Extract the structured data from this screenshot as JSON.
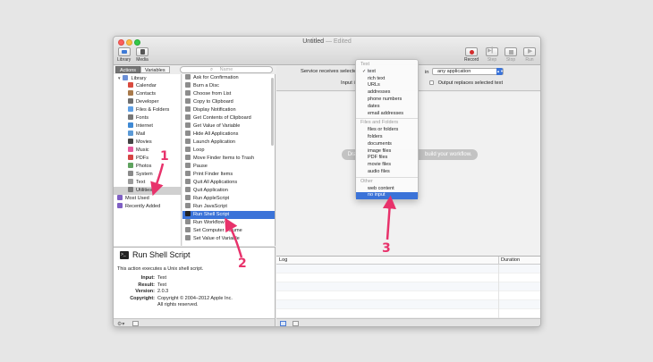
{
  "window": {
    "title": "Untitled",
    "title_suffix": "— Edited"
  },
  "toolbar": {
    "library_label": "Library",
    "media_label": "Media",
    "record_label": "Record",
    "step_label": "Step",
    "stop_label": "Stop",
    "run_label": "Run"
  },
  "library": {
    "actions_tab": "Actions",
    "variables_tab": "Variables",
    "search_placeholder": "Name",
    "categories": [
      {
        "label": "Library",
        "color": "#6b8fd6"
      },
      {
        "label": "Calendar",
        "color": "#d94b3f"
      },
      {
        "label": "Contacts",
        "color": "#a97a4b"
      },
      {
        "label": "Developer",
        "color": "#6f6f6f"
      },
      {
        "label": "Files & Folders",
        "color": "#5ea0e6"
      },
      {
        "label": "Fonts",
        "color": "#777777"
      },
      {
        "label": "Internet",
        "color": "#3f89d4"
      },
      {
        "label": "Mail",
        "color": "#5c9ad6"
      },
      {
        "label": "Movies",
        "color": "#444444"
      },
      {
        "label": "Music",
        "color": "#e55a9e"
      },
      {
        "label": "PDFs",
        "color": "#d64444"
      },
      {
        "label": "Photos",
        "color": "#5fa35f"
      },
      {
        "label": "System",
        "color": "#8a8a8a"
      },
      {
        "label": "Text",
        "color": "#9b9b9b"
      },
      {
        "label": "Utilities",
        "color": "#7b7b7b"
      },
      {
        "label": "Most Used",
        "color": "#7f5fc4"
      },
      {
        "label": "Recently Added",
        "color": "#7f5fc4"
      }
    ],
    "actions": [
      "Ask for Confirmation",
      "Burn a Disc",
      "Choose from List",
      "Copy to Clipboard",
      "Display Notification",
      "Get Contents of Clipboard",
      "Get Value of Variable",
      "Hide All Applications",
      "Launch Application",
      "Loop",
      "Move Finder Items to Trash",
      "Pause",
      "Print Finder Items",
      "Quit All Applications",
      "Quit Application",
      "Run AppleScript",
      "Run JavaScript",
      "Run Shell Script",
      "Run Workflow",
      "Set Computer Volume",
      "Set Value of Variable"
    ]
  },
  "description": {
    "title": "Run Shell Script",
    "icon_text": ">_",
    "text": "This action executes a Unix shell script.",
    "input_label": "Input:",
    "input_value": "Text",
    "result_label": "Result:",
    "result_value": "Text",
    "version_label": "Version:",
    "version_value": "2.0.3",
    "copyright_label": "Copyright:",
    "copyright_value": "Copyright © 2004–2012 Apple Inc. All rights reserved."
  },
  "workflow": {
    "service_label": "Service receives selected",
    "input_label": "Input i",
    "in_label": "in",
    "app_value": "any application",
    "output_checkbox": "Output replaces selected text",
    "hint_left": "Drag",
    "hint_right": "build your workflow.",
    "log_header": "Log",
    "duration_header": "Duration"
  },
  "dropdown": {
    "items": [
      {
        "label": "Text",
        "type": "section"
      },
      {
        "label": "text",
        "type": "item",
        "checked": true
      },
      {
        "label": "rich text",
        "type": "item"
      },
      {
        "label": "URLs",
        "type": "item"
      },
      {
        "label": "addresses",
        "type": "item"
      },
      {
        "label": "phone numbers",
        "type": "item"
      },
      {
        "label": "dates",
        "type": "item"
      },
      {
        "label": "email addresses",
        "type": "item"
      },
      {
        "label": "Files and Folders",
        "type": "section"
      },
      {
        "label": "files or folders",
        "type": "item"
      },
      {
        "label": "folders",
        "type": "item"
      },
      {
        "label": "documents",
        "type": "item"
      },
      {
        "label": "image files",
        "type": "item"
      },
      {
        "label": "PDF files",
        "type": "item"
      },
      {
        "label": "movie files",
        "type": "item"
      },
      {
        "label": "audio files",
        "type": "item"
      },
      {
        "label": "Other",
        "type": "section"
      },
      {
        "label": "web content",
        "type": "item"
      },
      {
        "label": "no input",
        "type": "item",
        "highlighted": true
      }
    ]
  },
  "annotations": {
    "one": "1",
    "two": "2",
    "three": "3",
    "color": "#e8326b"
  }
}
